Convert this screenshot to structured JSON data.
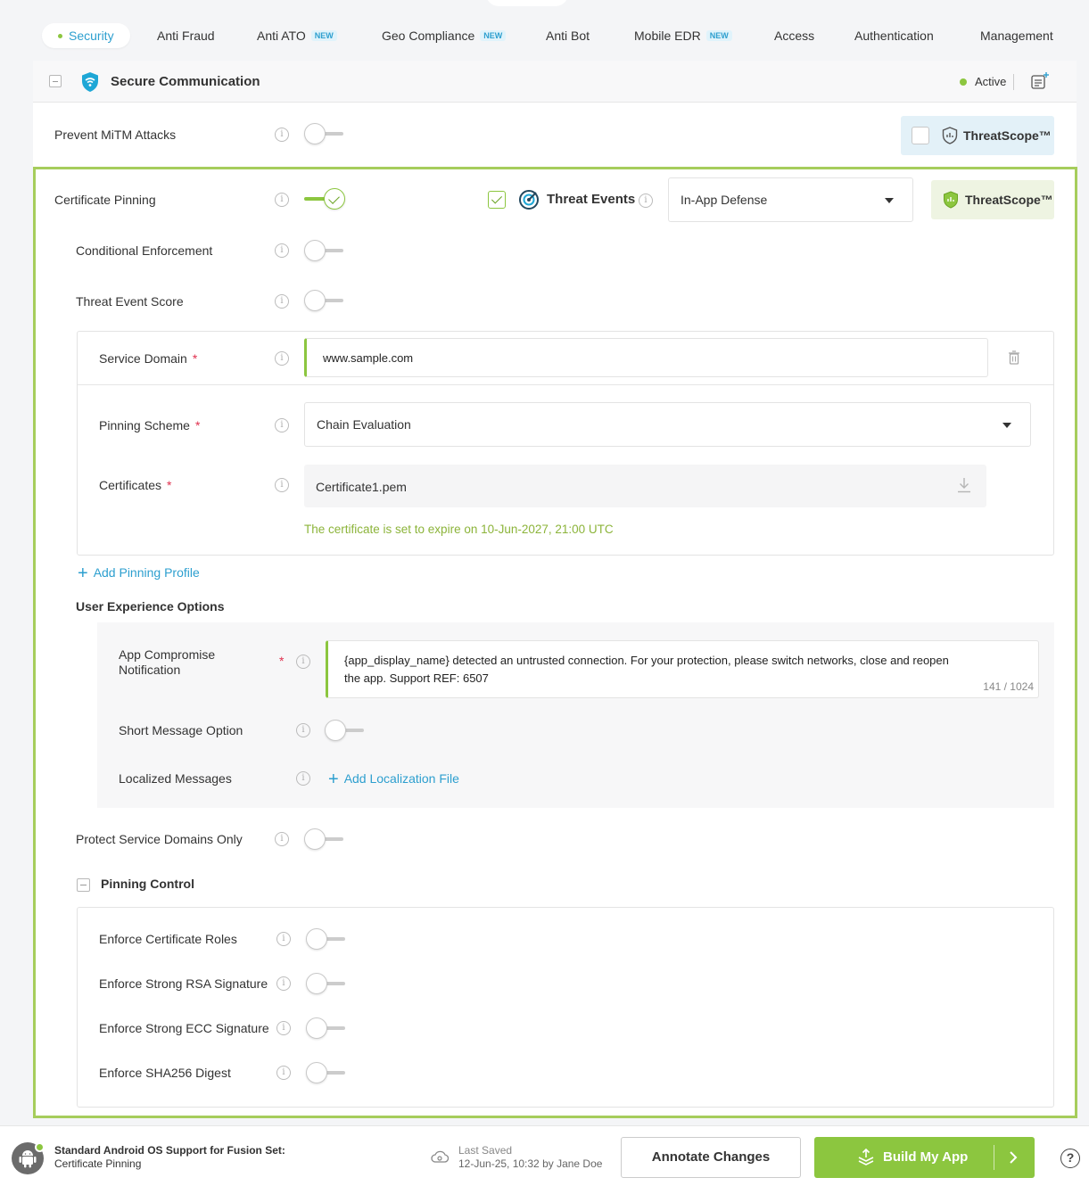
{
  "tabs": [
    {
      "label": "Security",
      "active": true,
      "is_new": false
    },
    {
      "label": "Anti Fraud",
      "active": false,
      "is_new": false
    },
    {
      "label": "Anti ATO",
      "active": false,
      "is_new": true
    },
    {
      "label": "Geo Compliance",
      "active": false,
      "is_new": true
    },
    {
      "label": "Anti Bot",
      "active": false,
      "is_new": false
    },
    {
      "label": "Mobile EDR",
      "active": false,
      "is_new": true
    },
    {
      "label": "Access",
      "active": false,
      "is_new": false
    },
    {
      "label": "Authentication",
      "active": false,
      "is_new": false
    },
    {
      "label": "Management",
      "active": false,
      "is_new": false
    }
  ],
  "new_badge": "NEW",
  "header": {
    "title": "Secure Communication",
    "status": "Active"
  },
  "mitm": {
    "label": "Prevent MiTM Attacks",
    "enabled": false,
    "threatscope_label": "ThreatScope™"
  },
  "cert_pinning": {
    "label": "Certificate Pinning",
    "enabled": true,
    "threat_events_label": "Threat Events",
    "threat_events_checked": true,
    "defense_value": "In-App Defense",
    "threatscope_label": "ThreatScope™"
  },
  "conditional_enforcement": {
    "label": "Conditional Enforcement",
    "enabled": false
  },
  "threat_event_score": {
    "label": "Threat Event Score",
    "enabled": false
  },
  "service_domain": {
    "label": "Service Domain",
    "required": "*",
    "value": "www.sample.com"
  },
  "pinning_scheme": {
    "label": "Pinning Scheme",
    "required": "*",
    "value": "Chain Evaluation"
  },
  "certificates": {
    "label": "Certificates",
    "required": "*",
    "value": "Certificate1.pem",
    "expiry_note": "The certificate is set to expire on 10-Jun-2027, 21:00 UTC"
  },
  "add_pinning_profile": "Add Pinning Profile",
  "ux_options": {
    "title": "User Experience Options",
    "app_compromise": {
      "label_line1": "App Compromise",
      "label_line2": "Notification",
      "required": "*",
      "message": "{app_display_name} detected an untrusted connection. For your protection, please switch networks, close and reopen the app. Support REF: 6507",
      "counter": "141 / 1024"
    },
    "short_message": {
      "label": "Short Message Option",
      "enabled": false
    },
    "localized_messages": {
      "label": "Localized Messages",
      "add_link": "Add Localization File"
    }
  },
  "protect_service_domains": {
    "label": "Protect Service Domains Only",
    "enabled": false
  },
  "pinning_control": {
    "title": "Pinning Control",
    "items": [
      {
        "label": "Enforce Certificate Roles",
        "enabled": false
      },
      {
        "label": "Enforce Strong RSA Signature",
        "enabled": false
      },
      {
        "label": "Enforce Strong ECC Signature",
        "enabled": false
      },
      {
        "label": "Enforce SHA256 Digest",
        "enabled": false
      }
    ]
  },
  "footer": {
    "app_title": "Standard Android OS Support for Fusion Set:",
    "app_subtitle": "Certificate Pinning",
    "last_saved_label": "Last Saved",
    "last_saved_value": "12-Jun-25, 10:32 by Jane Doe",
    "annotate_label": "Annotate Changes",
    "build_label": "Build My App"
  },
  "colors": {
    "accent_green": "#8cc63f",
    "accent_blue": "#2d9fcf",
    "required_red": "#e0304e"
  }
}
